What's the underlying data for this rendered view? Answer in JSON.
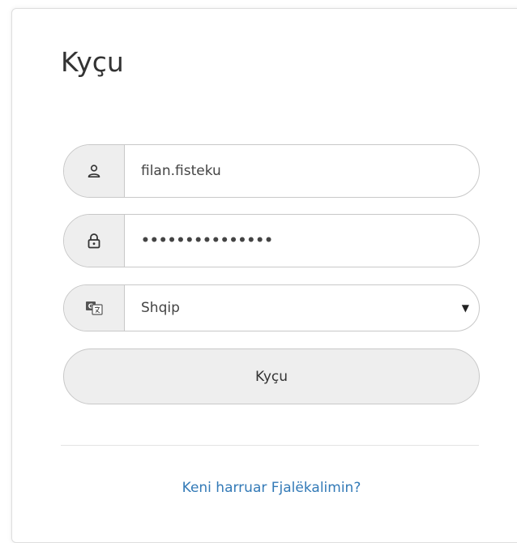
{
  "login": {
    "title": "Kyçu",
    "username_value": "filan.fisteku",
    "password_masked": "•••••••••••••••",
    "language_selected": "Shqip",
    "submit_label": "Kyçu",
    "forgot_link": "Keni harruar Fjalëkalimin?"
  },
  "icons": {
    "username": "user-icon",
    "password": "lock-icon",
    "language": "translate-icon",
    "select": "caret-down-icon"
  },
  "colors": {
    "link": "#337ab7",
    "addon_background": "#eeeeee",
    "border": "#c8c8c8"
  }
}
